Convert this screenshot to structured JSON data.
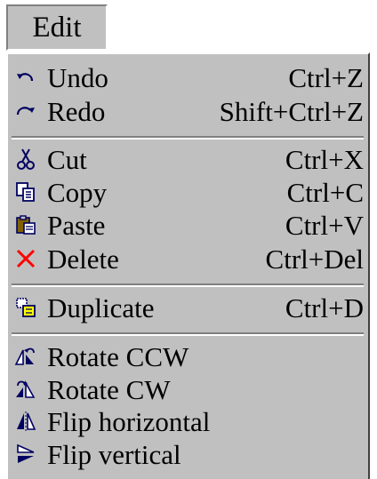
{
  "menubar": {
    "edit_label": "Edit"
  },
  "menu": {
    "items": [
      {
        "label": "Undo",
        "shortcut": "Ctrl+Z",
        "icon": "undo-icon"
      },
      {
        "label": "Redo",
        "shortcut": "Shift+Ctrl+Z",
        "icon": "redo-icon"
      },
      {
        "label": "Cut",
        "shortcut": "Ctrl+X",
        "icon": "scissors-icon"
      },
      {
        "label": "Copy",
        "shortcut": "Ctrl+C",
        "icon": "copy-icon"
      },
      {
        "label": "Paste",
        "shortcut": "Ctrl+V",
        "icon": "clipboard-icon"
      },
      {
        "label": "Delete",
        "shortcut": "Ctrl+Del",
        "icon": "delete-x-icon",
        "icon_color": "#ff0000"
      },
      {
        "label": "Duplicate",
        "shortcut": "Ctrl+D",
        "icon": "duplicate-icon"
      },
      {
        "label": "Rotate CCW",
        "shortcut": "",
        "icon": "rotate-ccw-icon"
      },
      {
        "label": "Rotate CW",
        "shortcut": "",
        "icon": "rotate-cw-icon"
      },
      {
        "label": "Flip horizontal",
        "shortcut": "",
        "icon": "flip-horizontal-icon"
      },
      {
        "label": "Flip vertical",
        "shortcut": "",
        "icon": "flip-vertical-icon"
      }
    ]
  },
  "colors": {
    "menu_bg": "#c0c0c0",
    "text": "#000000",
    "delete_icon": "#ff0000"
  }
}
